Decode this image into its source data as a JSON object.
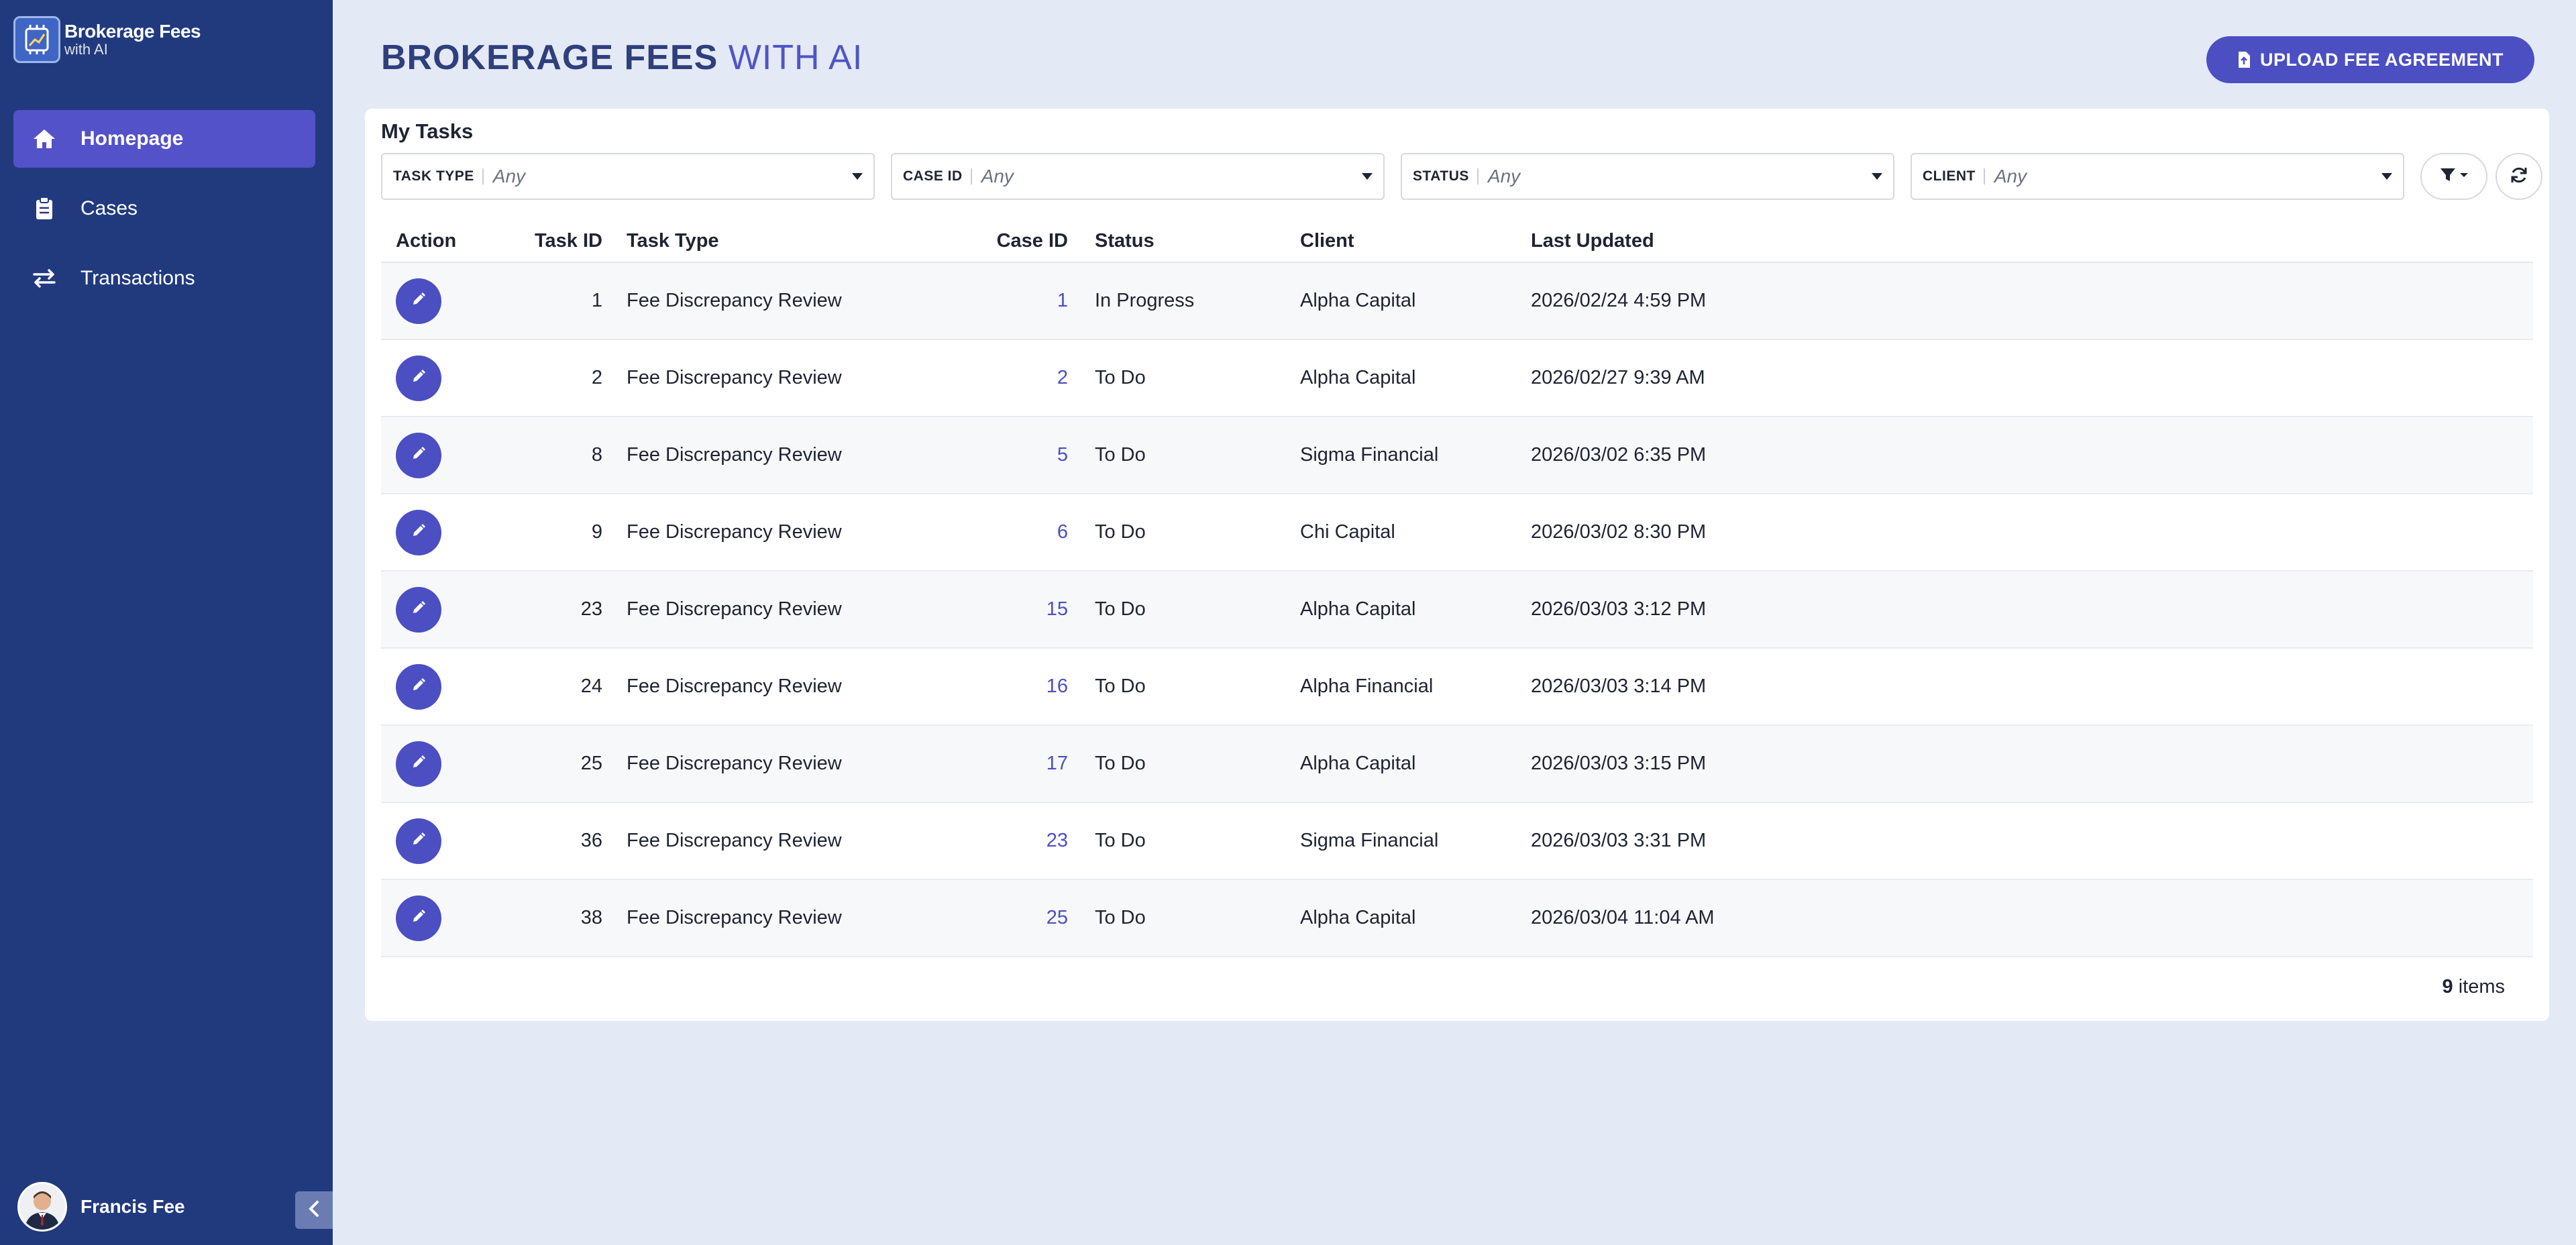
{
  "brand": {
    "title": "Brokerage Fees",
    "subtitle": "with AI"
  },
  "nav": [
    {
      "label": "Homepage",
      "icon": "home-icon",
      "active": true
    },
    {
      "label": "Cases",
      "icon": "clipboard-icon",
      "active": false
    },
    {
      "label": "Transactions",
      "icon": "exchange-icon",
      "active": false
    }
  ],
  "user": {
    "name": "Francis Fee"
  },
  "header": {
    "title_strong": "BROKERAGE FEES",
    "title_light": " WITH AI",
    "upload_label": "UPLOAD FEE AGREEMENT"
  },
  "tasks": {
    "title": "My Tasks",
    "filters": [
      {
        "label": "TASK TYPE",
        "value": "Any"
      },
      {
        "label": "CASE ID",
        "value": "Any"
      },
      {
        "label": "STATUS",
        "value": "Any"
      },
      {
        "label": "CLIENT",
        "value": "Any"
      }
    ],
    "columns": {
      "action": "Action",
      "task_id": "Task ID",
      "task_type": "Task Type",
      "case_id": "Case ID",
      "status": "Status",
      "client": "Client",
      "last_updated": "Last Updated"
    },
    "rows": [
      {
        "task_id": "1",
        "task_type": "Fee Discrepancy Review",
        "case_id": "1",
        "status": "In Progress",
        "client": "Alpha Capital",
        "last_updated": "2026/02/24 4:59 PM"
      },
      {
        "task_id": "2",
        "task_type": "Fee Discrepancy Review",
        "case_id": "2",
        "status": "To Do",
        "client": "Alpha Capital",
        "last_updated": "2026/02/27 9:39 AM"
      },
      {
        "task_id": "8",
        "task_type": "Fee Discrepancy Review",
        "case_id": "5",
        "status": "To Do",
        "client": "Sigma Financial",
        "last_updated": "2026/03/02 6:35 PM"
      },
      {
        "task_id": "9",
        "task_type": "Fee Discrepancy Review",
        "case_id": "6",
        "status": "To Do",
        "client": "Chi Capital",
        "last_updated": "2026/03/02 8:30 PM"
      },
      {
        "task_id": "23",
        "task_type": "Fee Discrepancy Review",
        "case_id": "15",
        "status": "To Do",
        "client": "Alpha Capital",
        "last_updated": "2026/03/03 3:12 PM"
      },
      {
        "task_id": "24",
        "task_type": "Fee Discrepancy Review",
        "case_id": "16",
        "status": "To Do",
        "client": "Alpha Financial",
        "last_updated": "2026/03/03 3:14 PM"
      },
      {
        "task_id": "25",
        "task_type": "Fee Discrepancy Review",
        "case_id": "17",
        "status": "To Do",
        "client": "Alpha Capital",
        "last_updated": "2026/03/03 3:15 PM"
      },
      {
        "task_id": "36",
        "task_type": "Fee Discrepancy Review",
        "case_id": "23",
        "status": "To Do",
        "client": "Sigma Financial",
        "last_updated": "2026/03/03 3:31 PM"
      },
      {
        "task_id": "38",
        "task_type": "Fee Discrepancy Review",
        "case_id": "25",
        "status": "To Do",
        "client": "Alpha Capital",
        "last_updated": "2026/03/04 11:04 AM"
      }
    ],
    "footer": {
      "count": "9",
      "suffix": " items"
    }
  },
  "colors": {
    "sidebar_bg": "#213a7e",
    "accent": "#4b4fc2",
    "nav_active": "#5352c9",
    "page_bg": "#e4e9f6"
  }
}
